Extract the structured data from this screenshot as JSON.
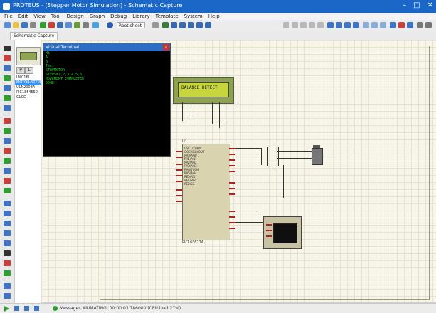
{
  "window": {
    "title": "PROTEUS - [Stepper Motor Simulation] - Schematic Capture"
  },
  "menu": [
    "File",
    "Edit",
    "View",
    "Tool",
    "Design",
    "Graph",
    "Debug",
    "Library",
    "Template",
    "System",
    "Help"
  ],
  "toolbar": {
    "combo_value": "Root sheet"
  },
  "tabs": [
    {
      "label": "Schematic Capture"
    }
  ],
  "device_panel": {
    "pick_label": "P",
    "lib_label": "L",
    "items": [
      "LM016L",
      "MOTOR-STEPPER",
      "ULN2003A",
      "PIC18F4550",
      "GLCD"
    ],
    "selected_index": 1
  },
  "lcd": {
    "text": "BALANCE DETECT"
  },
  "mcu": {
    "ref": "U1",
    "part": "PIC16F877A",
    "pins": [
      "OSC1/CLKIN",
      "OSC2/CLKOUT",
      "RA0/AN0",
      "RA1/AN1",
      "RA2/AN2",
      "RA3/AN3",
      "RA4/T0CKI",
      "RA5/AN4",
      "RE0/RD",
      "RE1/WR",
      "RE2/CS"
    ]
  },
  "terminal": {
    "title": "Virtual Terminal",
    "close_label": "x",
    "lines": [
      "Hi",
      "A",
      "B",
      "Test",
      "STEPMOTOR",
      "STEPS=1,2,3,4,5,6",
      "MOVEMENT COMPLETED",
      "DONE"
    ]
  },
  "statusbar": {
    "messages": "Messages",
    "info": "ANIMATING: 00:00:03.786000 (CPU load 27%)"
  },
  "colors": {
    "titlebar": "#1a67c8",
    "terminal_text": "#19d21f",
    "lcd_screen": "#c7d63f",
    "wire": "#333333"
  }
}
